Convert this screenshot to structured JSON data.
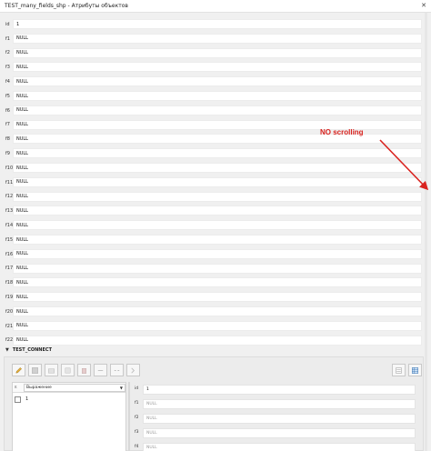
{
  "window": {
    "title": "TEST_many_fields_shp - Атрибуты объектов"
  },
  "fields": [
    {
      "label": "id",
      "value": "1"
    },
    {
      "label": "f1",
      "value": "NULL"
    },
    {
      "label": "f2",
      "value": "NULL"
    },
    {
      "label": "f3",
      "value": "NULL"
    },
    {
      "label": "f4",
      "value": "NULL"
    },
    {
      "label": "f5",
      "value": "NULL"
    },
    {
      "label": "f6",
      "value": "NULL"
    },
    {
      "label": "f7",
      "value": "NULL"
    },
    {
      "label": "f8",
      "value": "NULL"
    },
    {
      "label": "f9",
      "value": "NULL"
    },
    {
      "label": "f10",
      "value": "NULL"
    },
    {
      "label": "f11",
      "value": "NULL"
    },
    {
      "label": "f12",
      "value": "NULL"
    },
    {
      "label": "f13",
      "value": "NULL"
    },
    {
      "label": "f14",
      "value": "NULL"
    },
    {
      "label": "f15",
      "value": "NULL"
    },
    {
      "label": "f16",
      "value": "NULL"
    },
    {
      "label": "f17",
      "value": "NULL"
    },
    {
      "label": "f18",
      "value": "NULL"
    },
    {
      "label": "f19",
      "value": "NULL"
    },
    {
      "label": "f20",
      "value": "NULL"
    },
    {
      "label": "f21",
      "value": "NULL"
    },
    {
      "label": "f22",
      "value": "NULL"
    }
  ],
  "annotation": {
    "text": "NO scrolling",
    "color": "#d9231f"
  },
  "relation": {
    "name": "TEST_CONNECT",
    "expression_label": "Выражение",
    "list_items": [
      "1"
    ],
    "sub_fields": [
      {
        "label": "id",
        "value": "1"
      },
      {
        "label": "f1",
        "value": "NULL"
      },
      {
        "label": "f2",
        "value": "NULL"
      },
      {
        "label": "f3",
        "value": "NULL"
      },
      {
        "label": "f4",
        "value": "NULL"
      }
    ]
  }
}
